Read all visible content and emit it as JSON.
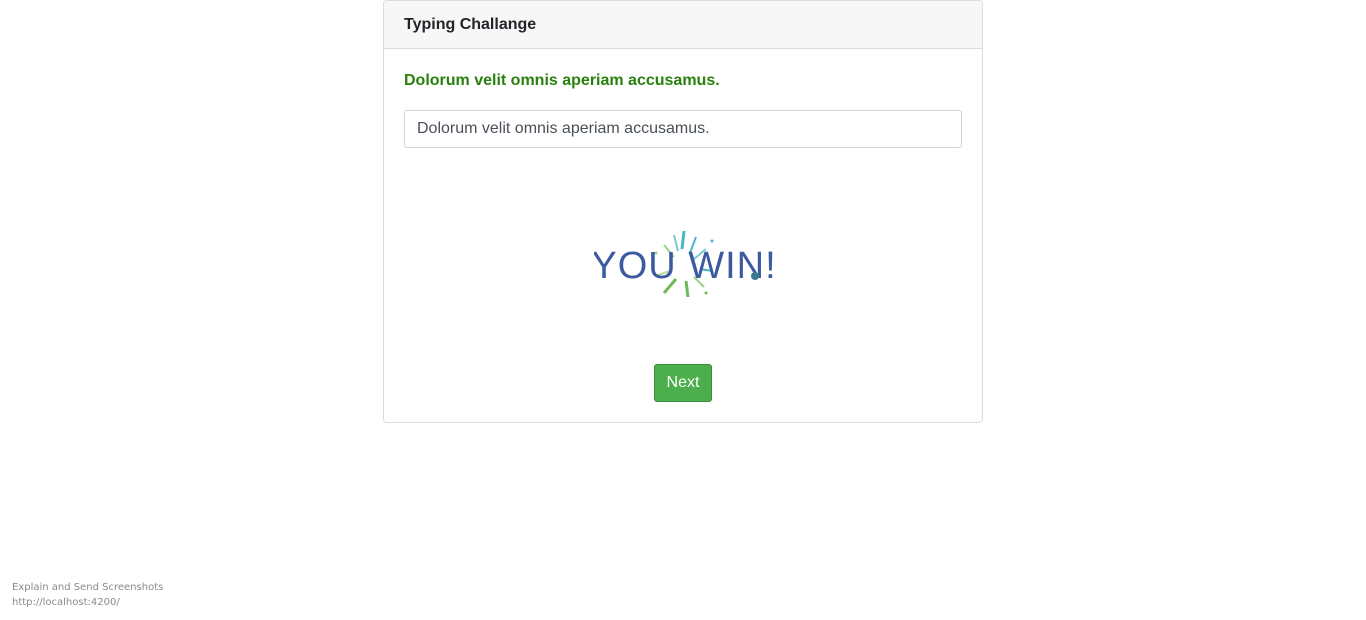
{
  "card": {
    "title": "Typing Challange",
    "target_sentence": "Dolorum velit omnis aperiam accusamus.",
    "input_value": "Dolorum velit omnis aperiam accusamus.",
    "win_graphic_text": "YOU WIN!",
    "next_label": "Next"
  },
  "footer": {
    "line1": "Explain and Send Screenshots",
    "line2": "http://localhost:4200/"
  },
  "colors": {
    "target_text": "#28800e",
    "next_button": "#4cae4c",
    "win_text": "#3c5aa0"
  }
}
